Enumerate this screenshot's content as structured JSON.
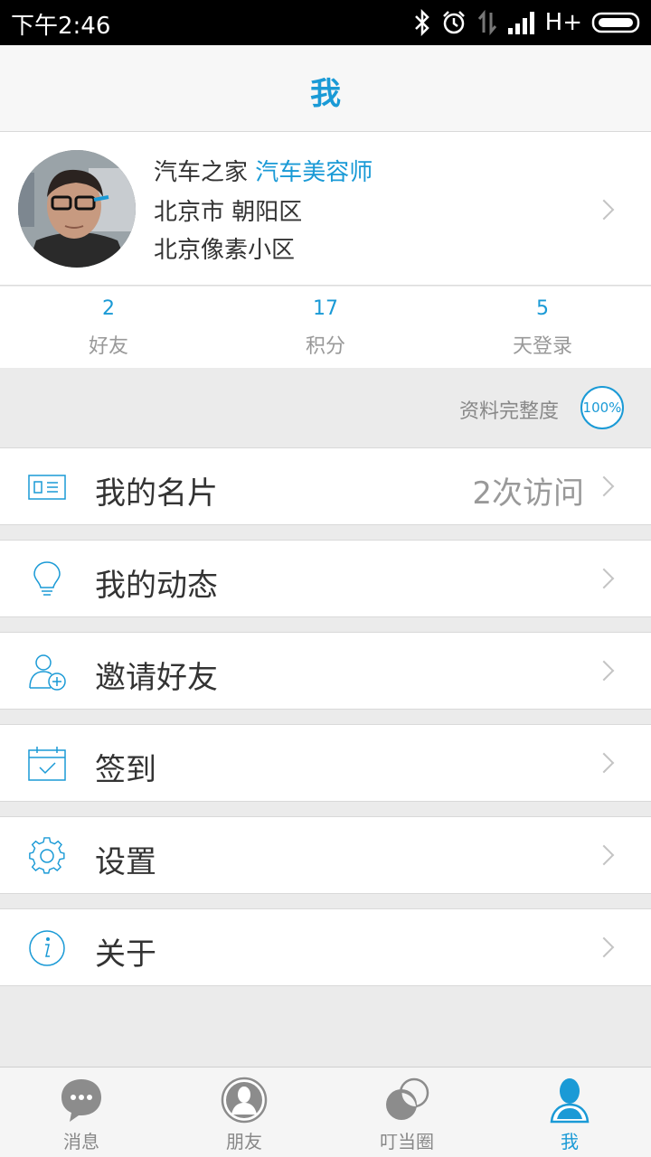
{
  "status_bar": {
    "time": "下午2:46",
    "network": "H+"
  },
  "header": {
    "title": "我"
  },
  "profile": {
    "company": "汽车之家",
    "role": "汽车美容师",
    "location": "北京市 朝阳区",
    "community": "北京像素小区"
  },
  "stats": [
    {
      "value": "2",
      "label": "好友"
    },
    {
      "value": "17",
      "label": "积分"
    },
    {
      "value": "5",
      "label": "天登录"
    }
  ],
  "completeness": {
    "label": "资料完整度",
    "value": "100%"
  },
  "menu": [
    {
      "label": "我的名片",
      "extra": "2次访问",
      "icon": "business-card-icon"
    },
    {
      "label": "我的动态",
      "extra": "",
      "icon": "lightbulb-icon"
    },
    {
      "label": "邀请好友",
      "extra": "",
      "icon": "add-user-icon"
    },
    {
      "label": "签到",
      "extra": "",
      "icon": "calendar-check-icon"
    },
    {
      "label": "设置",
      "extra": "",
      "icon": "gear-icon"
    },
    {
      "label": "关于",
      "extra": "",
      "icon": "info-icon"
    }
  ],
  "tabs": [
    {
      "label": "消息",
      "icon": "chat-bubble-icon"
    },
    {
      "label": "朋友",
      "icon": "person-circle-icon"
    },
    {
      "label": "叮当圈",
      "icon": "circles-icon"
    },
    {
      "label": "我",
      "icon": "person-icon",
      "active": true
    }
  ],
  "colors": {
    "accent": "#1a9ad6",
    "background": "#ebebeb"
  }
}
